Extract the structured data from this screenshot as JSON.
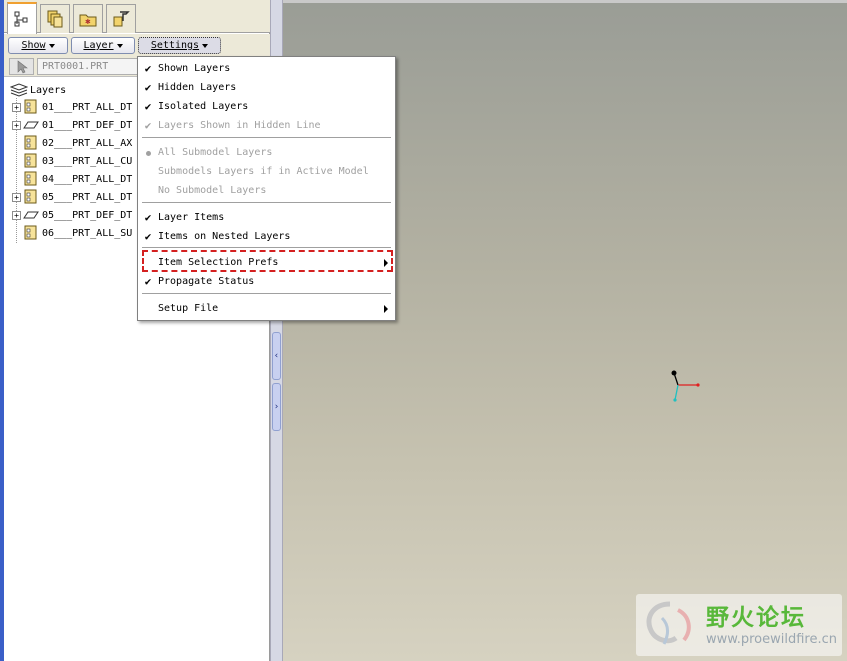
{
  "tabs": [
    {
      "icon": "model-tree-icon",
      "active": true
    },
    {
      "icon": "layers-icon",
      "active": false
    },
    {
      "icon": "favorites-folder-icon",
      "active": false
    },
    {
      "icon": "connections-icon",
      "active": false
    }
  ],
  "toolbar": {
    "show_label": "Show",
    "layer_label": "Layer",
    "settings_label": "Settings"
  },
  "model": {
    "name": "PRT0001.PRT"
  },
  "tree": {
    "root_label": "Layers",
    "rows": [
      {
        "label": "01___PRT_ALL_DT",
        "expandable": true,
        "icon": "layer-doc-icon"
      },
      {
        "label": "01___PRT_DEF_DT",
        "expandable": true,
        "icon": "layer-plane-icon"
      },
      {
        "label": "02___PRT_ALL_AX",
        "expandable": false,
        "icon": "layer-doc-icon"
      },
      {
        "label": "03___PRT_ALL_CU",
        "expandable": false,
        "icon": "layer-doc-icon"
      },
      {
        "label": "04___PRT_ALL_DT",
        "expandable": false,
        "icon": "layer-doc-icon"
      },
      {
        "label": "05___PRT_ALL_DT",
        "expandable": true,
        "icon": "layer-doc-icon"
      },
      {
        "label": "05___PRT_DEF_DT",
        "expandable": true,
        "icon": "layer-plane-icon"
      },
      {
        "label": "06___PRT_ALL_SU",
        "expandable": false,
        "icon": "layer-doc-icon"
      }
    ]
  },
  "settings_menu": {
    "items": [
      {
        "label": "Shown Layers",
        "checked": true,
        "enabled": true
      },
      {
        "label": "Hidden Layers",
        "checked": true,
        "enabled": true
      },
      {
        "label": "Isolated Layers",
        "checked": true,
        "enabled": true
      },
      {
        "label": "Layers Shown in Hidden Line",
        "checked": true,
        "enabled": false
      },
      {
        "label": "All Submodel Layers",
        "radio": true,
        "enabled": false
      },
      {
        "label": "Submodels Layers if in Active Model",
        "enabled": false
      },
      {
        "label": "No Submodel Layers",
        "enabled": false
      },
      {
        "label": "Layer Items",
        "checked": true,
        "enabled": true
      },
      {
        "label": "Items on Nested Layers",
        "checked": true,
        "enabled": true
      },
      {
        "label": "Item Selection Prefs",
        "submenu": true,
        "enabled": true,
        "highlighted": true
      },
      {
        "label": "Propagate Status",
        "checked": true,
        "enabled": true
      },
      {
        "label": "Setup File",
        "submenu": true,
        "enabled": true
      }
    ]
  },
  "splitter": {
    "collapse_glyph": "‹",
    "expand_glyph": "›"
  },
  "watermark": {
    "title": "野火论坛",
    "url": "www.proewildfire.cn"
  },
  "colors": {
    "highlight_box": "#d42020",
    "tab_accent": "#f0a030",
    "csys_x": "#e02020",
    "csys_y": "#000000",
    "csys_z": "#20c0c0"
  }
}
